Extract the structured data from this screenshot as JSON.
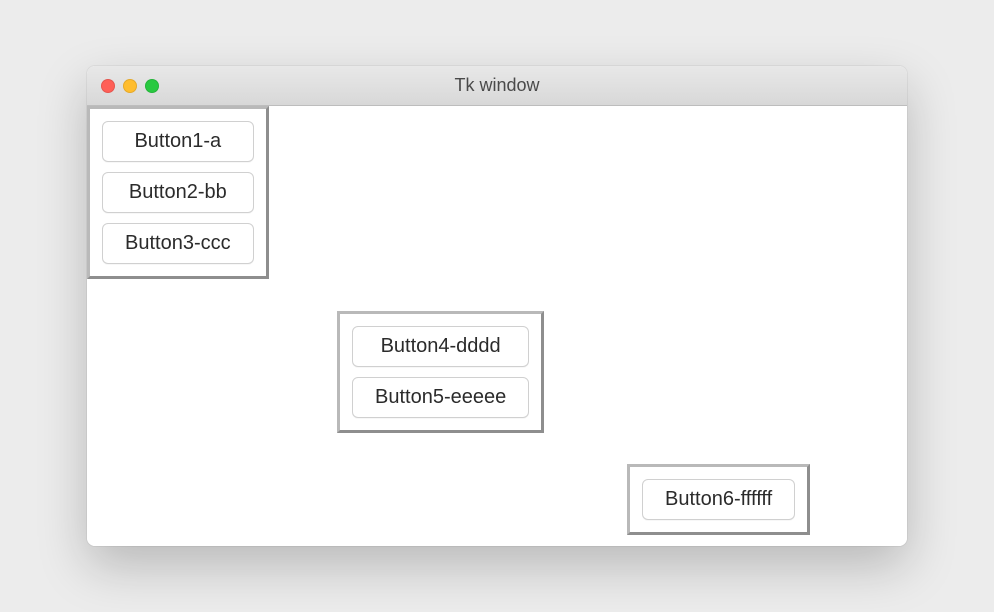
{
  "window": {
    "title": "Tk window"
  },
  "frames": {
    "frame1": {
      "buttons": [
        {
          "label": "Button1-a"
        },
        {
          "label": "Button2-bb"
        },
        {
          "label": "Button3-ccc"
        }
      ]
    },
    "frame2": {
      "buttons": [
        {
          "label": "Button4-dddd"
        },
        {
          "label": "Button5-eeeee"
        }
      ]
    },
    "frame3": {
      "buttons": [
        {
          "label": "Button6-ffffff"
        }
      ]
    }
  }
}
